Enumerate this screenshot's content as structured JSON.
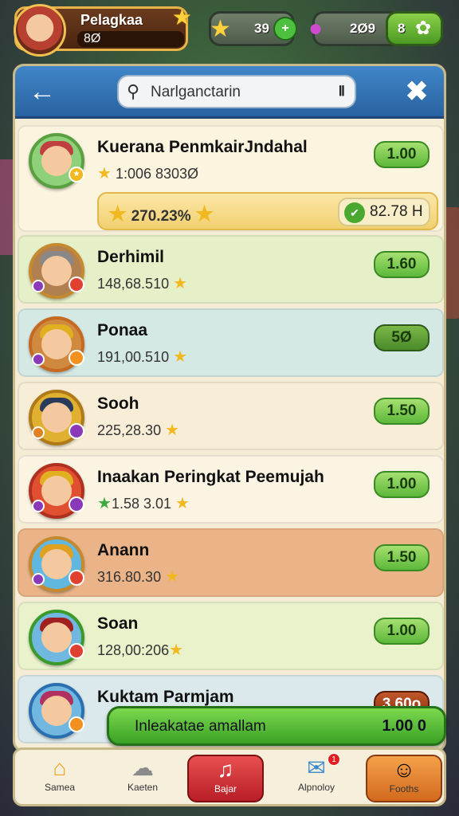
{
  "top_bar": {
    "player_name": "Pelagkaa",
    "player_level": "8Ø",
    "stars_value": "39",
    "gems_value": "2Ø9",
    "gems_secondary": "8"
  },
  "header": {
    "back_icon": "arrow-left-icon",
    "close_icon": "close-icon",
    "search_value": "Narlganctarin",
    "search_suffix": "Ⅱ"
  },
  "rows": [
    {
      "name": "Kuerana PenmkairJndahal",
      "score": "1:006 8303Ø",
      "button": "1.00"
    },
    {
      "name": "Derhimil",
      "score": "148,68.510",
      "button": "1.60"
    },
    {
      "name": "Ponaa",
      "score": "191,00.510",
      "button": "5Ø"
    },
    {
      "name": "Sooh",
      "score": "225,28.30",
      "button": "1.50"
    },
    {
      "name": "Inaakan Peringkat Peemujah",
      "score": "1.58 3.01",
      "button": "1.00"
    },
    {
      "name": "Anann",
      "score": "316.80.30",
      "button": "1.50"
    },
    {
      "name": "Soan",
      "score": "128,00:206",
      "button": "1.00"
    },
    {
      "name": "Kuktam Parmjam",
      "score": "",
      "button": "3.60ο"
    }
  ],
  "bonus": {
    "left": "270.23%",
    "right": "82.78 H"
  },
  "cta": {
    "label": "Inleakatae amallam",
    "value": "1.00 0"
  },
  "nav": [
    {
      "label": "Samea",
      "icon": "home-icon"
    },
    {
      "label": "Kaeten",
      "icon": "chat-icon"
    },
    {
      "label": "Bajar",
      "icon": "music-note-icon"
    },
    {
      "label": "Alpnoloy",
      "icon": "message-icon",
      "badge": "1"
    },
    {
      "label": "Fooths",
      "icon": "character-icon"
    }
  ],
  "colors": {
    "accent_green": "#5cb83a",
    "header_blue": "#2a62a0",
    "panel": "#f4ecd4"
  }
}
